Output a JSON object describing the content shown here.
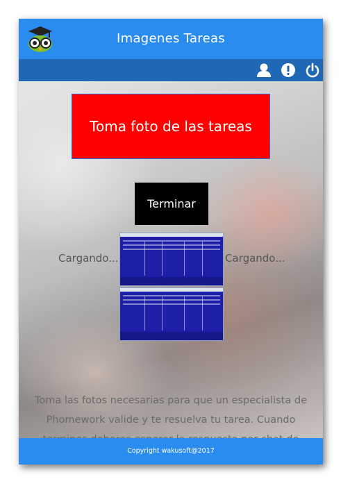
{
  "header": {
    "title": "Imagenes Tareas",
    "logo_icon": "owl-graduate-icon"
  },
  "toolbar": {
    "icons": [
      "user-icon",
      "exclamation-icon",
      "power-icon"
    ]
  },
  "main": {
    "take_photo_label": "Toma foto de las tareas",
    "finish_label": "Terminar",
    "loading_left": "Cargando...",
    "loading_right": "Cargando...",
    "description": "Toma las fotos necesarias para que un especialista de Phomework valide y te resuelva tu tarea. Cuando termines deberas esperar la respuesta por chat de"
  },
  "footer": {
    "copyright": "Copyright wakusoft@2017"
  },
  "colors": {
    "header_blue": "#2b8cf0",
    "toolbar_blue": "#1f68b6",
    "photo_button_red": "#ff0000",
    "finish_button_black": "#000000"
  }
}
